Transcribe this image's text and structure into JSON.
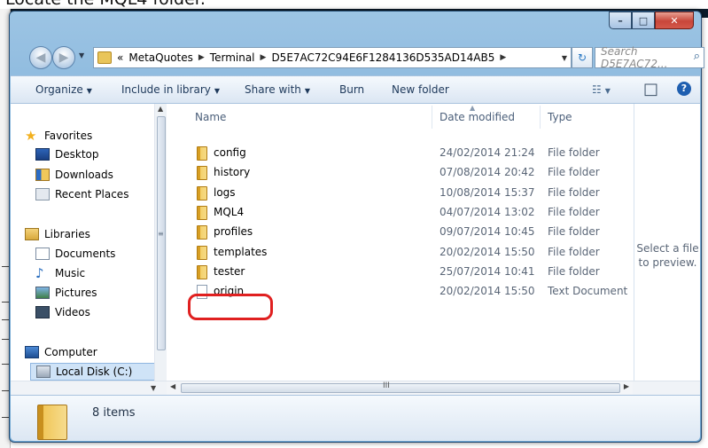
{
  "caption": "Locate the MQL4 folder.",
  "window": {
    "controls": {
      "minimize": "–",
      "maximize": "□",
      "close": "✕"
    }
  },
  "nav": {
    "back_glyph": "◀",
    "forward_glyph": "▶",
    "dropdown_glyph": "▼",
    "address": {
      "overflow": "«",
      "crumbs": [
        "MetaQuotes",
        "Terminal",
        "D5E7AC72C94E6F1284136D535AD14AB5"
      ],
      "separator": "▶",
      "dropdown": "▼"
    },
    "refresh_glyph": "↻",
    "search_placeholder": "Search D5E7AC72...",
    "search_icon": "⌕"
  },
  "toolbar": {
    "organize": "Organize",
    "include_in_library": "Include in library",
    "share_with": "Share with",
    "burn": "Burn",
    "new_folder": "New folder",
    "arrow": "▼",
    "view_glyph": "☷",
    "preview_glyph": "□",
    "help_glyph": "?"
  },
  "navpane": {
    "favorites": "Favorites",
    "desktop": "Desktop",
    "downloads": "Downloads",
    "recent_places": "Recent Places",
    "libraries": "Libraries",
    "documents": "Documents",
    "music": "Music",
    "pictures": "Pictures",
    "videos": "Videos",
    "computer": "Computer",
    "local_disk": "Local Disk (C:)"
  },
  "columns": {
    "name": "Name",
    "date_modified": "Date modified",
    "type": "Type"
  },
  "files": [
    {
      "name": "config",
      "date": "24/02/2014 21:24",
      "type": "File folder",
      "kind": "folder"
    },
    {
      "name": "history",
      "date": "07/08/2014 20:42",
      "type": "File folder",
      "kind": "folder"
    },
    {
      "name": "logs",
      "date": "10/08/2014 15:37",
      "type": "File folder",
      "kind": "folder"
    },
    {
      "name": "MQL4",
      "date": "04/07/2014 13:02",
      "type": "File folder",
      "kind": "folder"
    },
    {
      "name": "profiles",
      "date": "09/07/2014 10:45",
      "type": "File folder",
      "kind": "folder"
    },
    {
      "name": "templates",
      "date": "20/02/2014 15:50",
      "type": "File folder",
      "kind": "folder"
    },
    {
      "name": "tester",
      "date": "25/07/2014 10:41",
      "type": "File folder",
      "kind": "folder"
    },
    {
      "name": "origin",
      "date": "20/02/2014 15:50",
      "type": "Text Document",
      "kind": "file"
    }
  ],
  "preview": {
    "line1": "Select a file",
    "line2": "to preview."
  },
  "details": {
    "count": "8 items"
  },
  "colors": {
    "highlight": "#e02020",
    "accent": "#1e395b"
  }
}
